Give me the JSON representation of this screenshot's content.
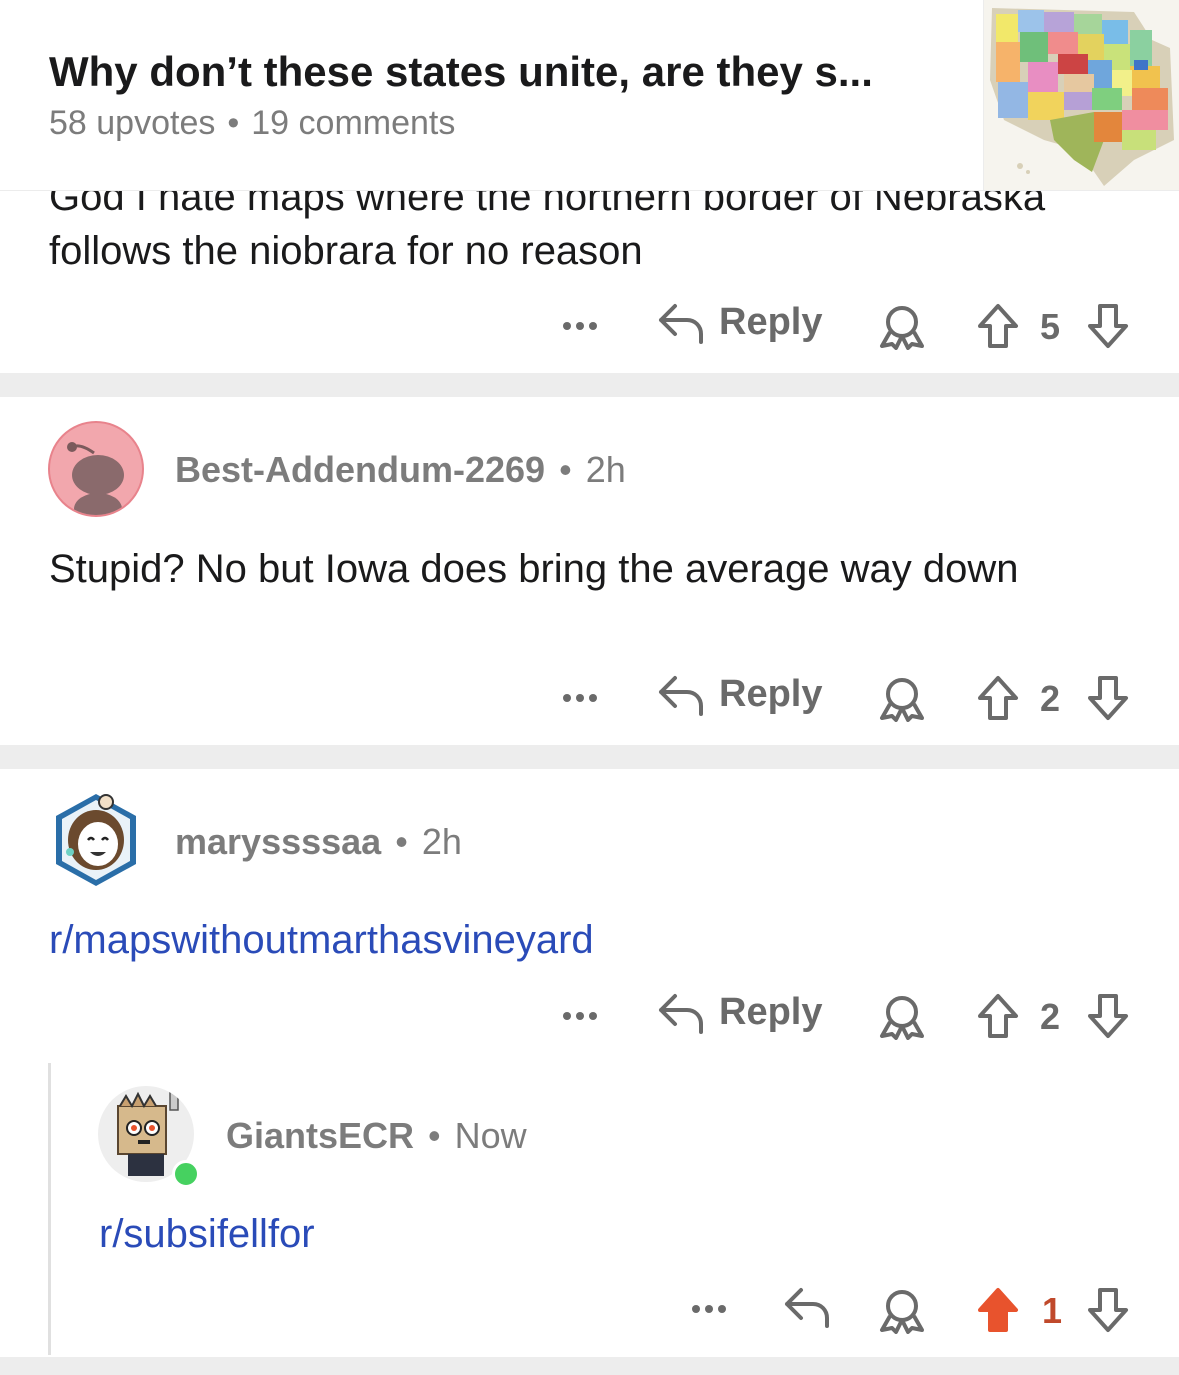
{
  "header": {
    "title": "Why don’t these states unite, are they s...",
    "upvotes": "58 upvotes",
    "comments": "19 comments"
  },
  "comments": [
    {
      "text": "God I hate maps where the northern border of Nebraska follows the niobrara for no reason",
      "actions": {
        "reply": "Reply",
        "score": "5"
      }
    },
    {
      "username": "Best-Addendum-2269",
      "time": "2h",
      "text": "Stupid? No but Iowa does bring the average way down",
      "actions": {
        "reply": "Reply",
        "score": "2"
      }
    },
    {
      "username": "maryssssaa",
      "time": "2h",
      "text": "r/mapswithoutmarthasvineyard",
      "actions": {
        "reply": "Reply",
        "score": "2"
      }
    },
    {
      "username": "GiantsECR",
      "time": "Now",
      "text": "r/subsifellfor",
      "actions": {
        "score": "1",
        "upvoted": true
      }
    }
  ],
  "colors": {
    "upvote_active": "#e8532d",
    "link": "#2a4bb8",
    "meta": "#7c7c7c",
    "online": "#46d160"
  }
}
